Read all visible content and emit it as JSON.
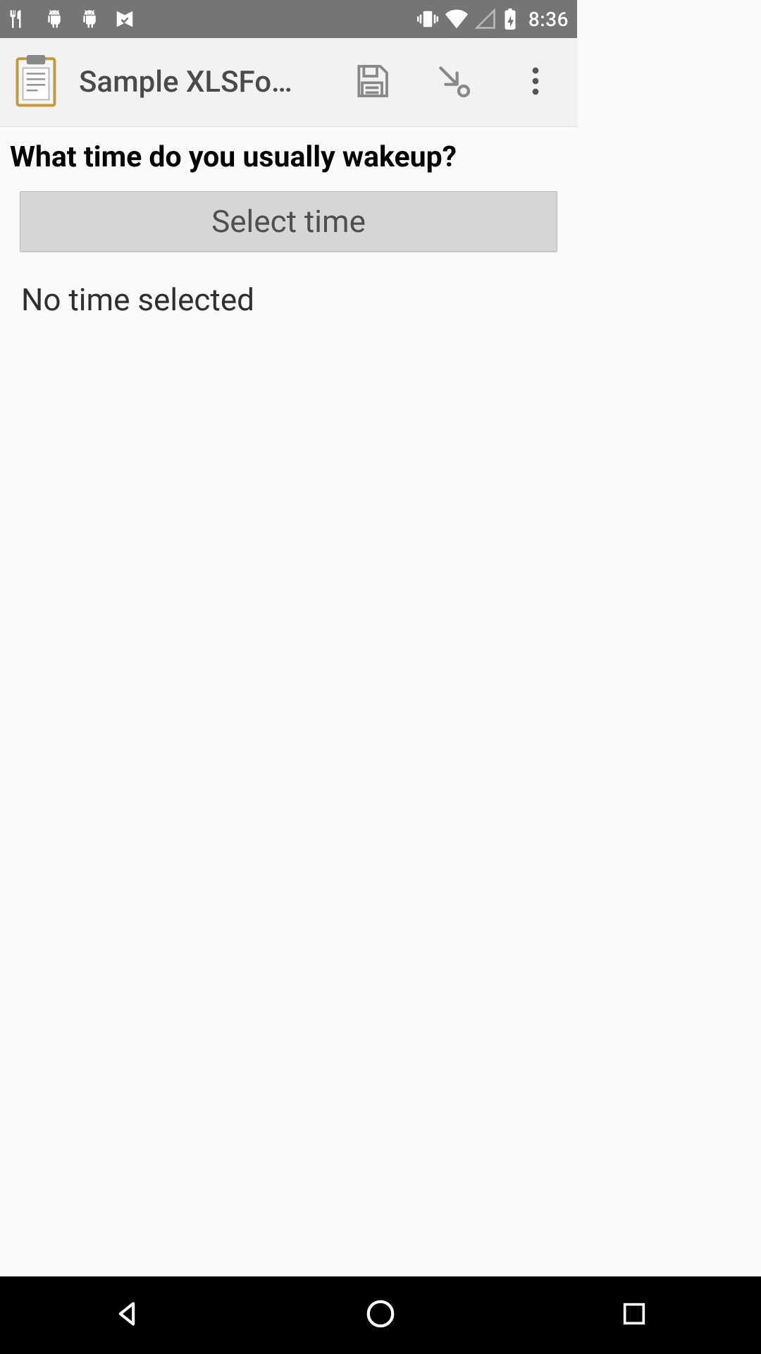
{
  "status_bar": {
    "time": "8:36"
  },
  "app_bar": {
    "title": "Sample XLSFo…"
  },
  "question": "What time do you usually wakeup?",
  "select_button_label": "Select time",
  "selected_time_text": "No time selected"
}
